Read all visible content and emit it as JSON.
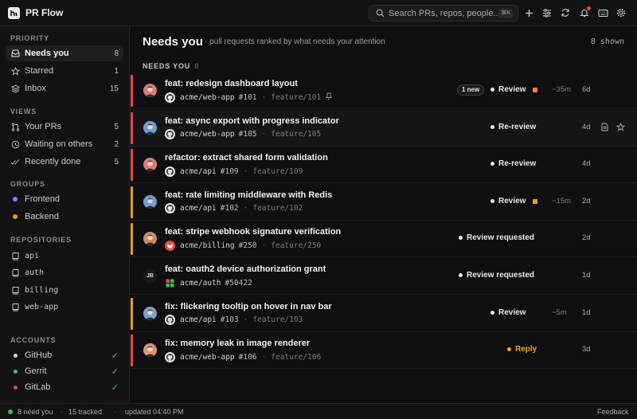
{
  "app": {
    "title": "PR Flow"
  },
  "search": {
    "placeholder": "Search PRs, repos, people...",
    "shortcut": "⌘K"
  },
  "header_buttons": [
    "plus-icon",
    "sliders-icon",
    "refresh-icon",
    "bell-icon",
    "keyboard-icon",
    "gear-icon"
  ],
  "sidebar": {
    "sections": {
      "priority": "PRIORITY",
      "views": "VIEWS",
      "groups": "GROUPS",
      "repositories": "REPOSITORIES",
      "accounts": "ACCOUNTS"
    },
    "priority": [
      {
        "label": "Needs you",
        "count": "8",
        "icon": "inbox-icon",
        "active": true
      },
      {
        "label": "Starred",
        "count": "1",
        "icon": "star-icon"
      },
      {
        "label": "Inbox",
        "count": "15",
        "icon": "layers-icon"
      }
    ],
    "views": [
      {
        "label": "Your PRs",
        "count": "5",
        "icon": "git-pr-icon"
      },
      {
        "label": "Waiting on others",
        "count": "2",
        "icon": "clock-icon"
      },
      {
        "label": "Recently done",
        "count": "5",
        "icon": "check-double-icon"
      }
    ],
    "groups": [
      {
        "label": "Frontend",
        "color": "#a371f7"
      },
      {
        "label": "Backend",
        "color": "#e3a21a"
      }
    ],
    "repositories": [
      {
        "label": "api"
      },
      {
        "label": "auth"
      },
      {
        "label": "billing"
      },
      {
        "label": "web-app"
      }
    ],
    "accounts": [
      {
        "label": "GitHub",
        "color": "#d4d4d8",
        "check": "✓"
      },
      {
        "label": "Gerrit",
        "color": "#3fb9a0",
        "check": "✓"
      },
      {
        "label": "GitLab",
        "color": "#e5484d",
        "check": "✓"
      }
    ]
  },
  "main": {
    "title": "Needs you",
    "subtitle": "· pull requests ranked by what needs your attention",
    "shown": "8 shown",
    "group_label": "NEEDS YOU",
    "group_count": "8"
  },
  "rows": [
    {
      "title": "feat: redesign dashboard layout",
      "repo": "acme/web-app",
      "number": "#101",
      "branch": "feature/101",
      "status": "Review",
      "age": "~35m",
      "when": "6d",
      "new_badge": "1 new",
      "square": "#f0852e",
      "bar": "#e5484d",
      "source": "github",
      "avatar": "#d97a7a"
    },
    {
      "title": "feat: async export with progress indicator",
      "repo": "acme/web-app",
      "number": "#105",
      "branch": "feature/105",
      "status": "Re-review",
      "age": "",
      "when": "4d",
      "bar": "#e5484d",
      "source": "github",
      "avatar": "#6a9fd4"
    },
    {
      "title": "refactor: extract shared form validation",
      "repo": "acme/api",
      "number": "#109",
      "branch": "feature/109",
      "status": "Re-review",
      "age": "",
      "when": "4d",
      "bar": "#e5484d",
      "source": "github",
      "avatar": "#d97a7a"
    },
    {
      "title": "feat: rate limiting middleware with Redis",
      "repo": "acme/api",
      "number": "#102",
      "branch": "feature/102",
      "status": "Review",
      "age": "~15m",
      "when": "2d",
      "square": "#e3a21a",
      "bar": "#e3a21a",
      "source": "github",
      "avatar": "#6a9fd4"
    },
    {
      "title": "feat: stripe webhook signature verification",
      "repo": "acme/billing",
      "number": "#250",
      "branch": "feature/250",
      "status": "Review requested",
      "age": "",
      "when": "2d",
      "bar": "#e3a21a",
      "source": "gitlab",
      "avatar": "#c48b6a"
    },
    {
      "title": "feat: oauth2 device authorization grant",
      "repo": "acme/auth",
      "number": "#50422",
      "branch": "",
      "status": "Review requested",
      "age": "",
      "when": "1d",
      "bar": "",
      "source": "gerrit",
      "avatar": "initials",
      "initials": "JB"
    },
    {
      "title": "fix: flickering tooltip on hover in nav bar",
      "repo": "acme/api",
      "number": "#103",
      "branch": "feature/103",
      "status": "Review",
      "age": "~5m",
      "when": "1d",
      "bar": "#e3a21a",
      "source": "github",
      "avatar": "#7aa0c8"
    },
    {
      "title": "fix: memory leak in image renderer",
      "repo": "acme/web-app",
      "number": "#106",
      "branch": "feature/106",
      "status": "Reply",
      "age": "",
      "when": "3d",
      "bar": "#e5484d",
      "source": "github",
      "avatar": "#d9937a",
      "reply": true
    }
  ],
  "footer": {
    "needs": "8 need you",
    "tracked": "15 tracked",
    "updated": "updated 04:40 PM",
    "feedback": "Feedback"
  }
}
